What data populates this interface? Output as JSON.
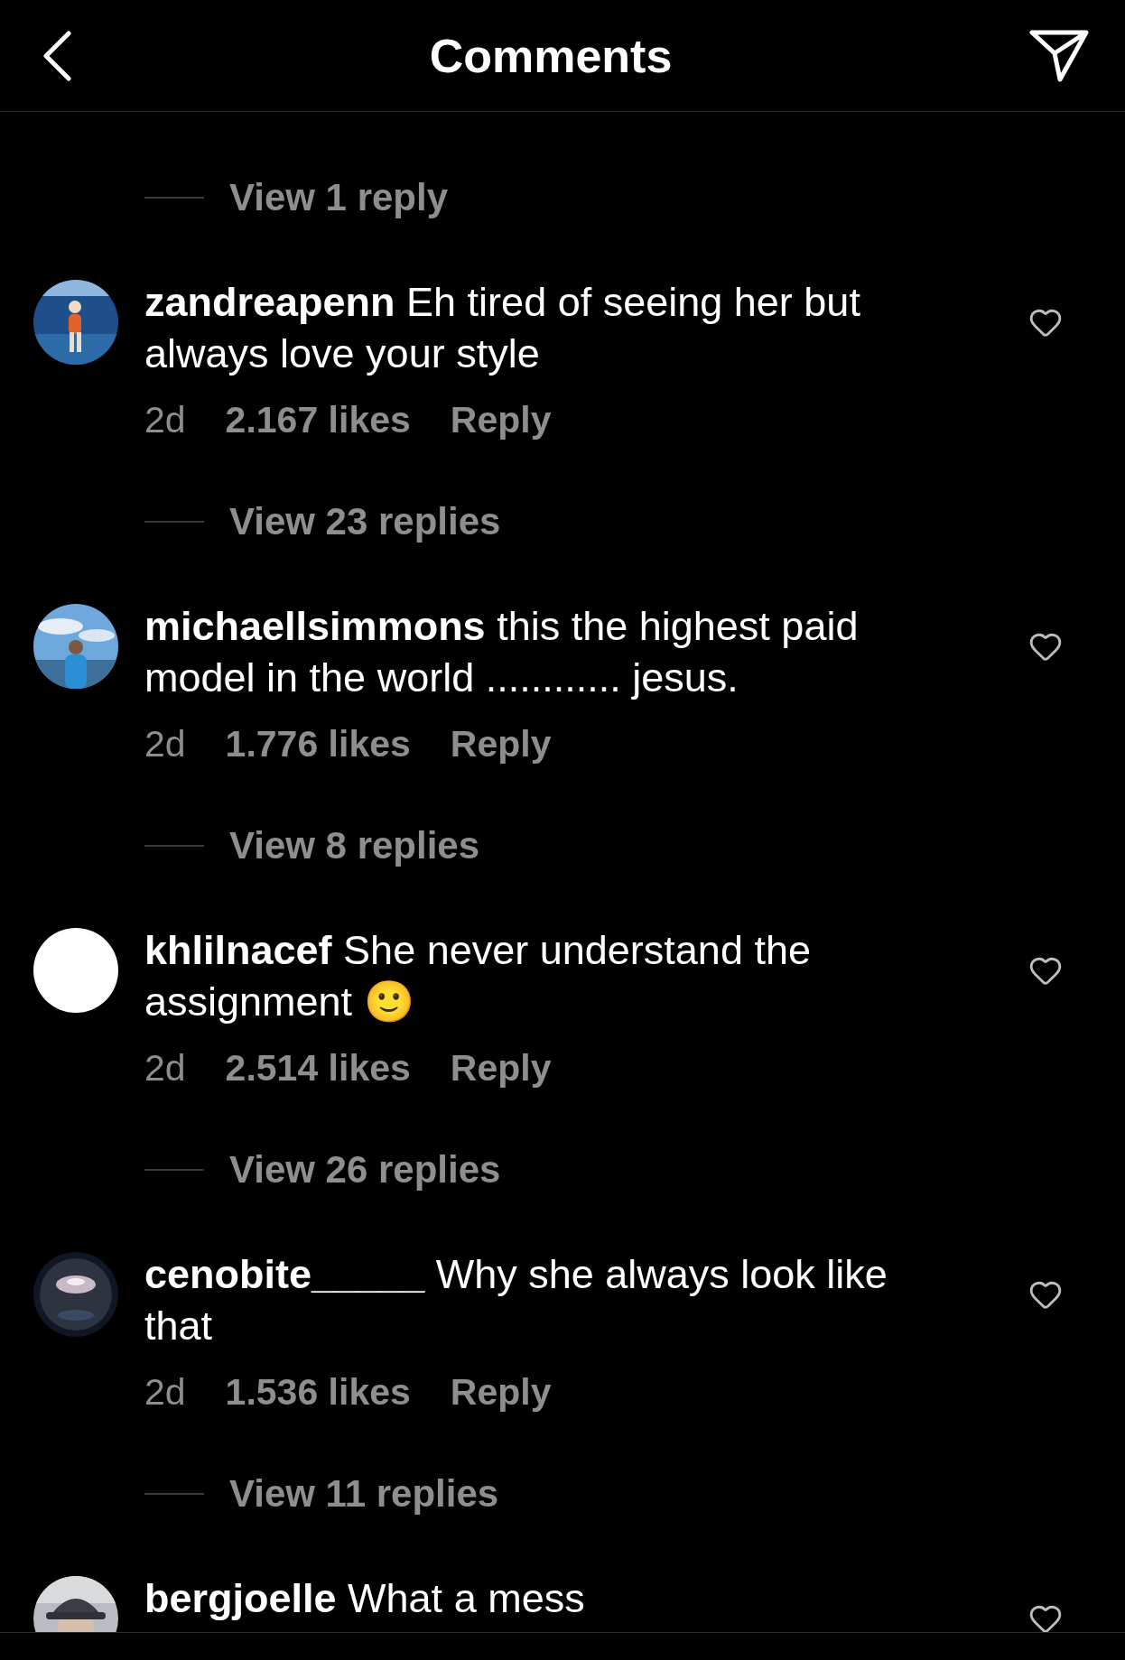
{
  "header": {
    "title": "Comments"
  },
  "comments": [
    {
      "view_replies": "View 1 reply",
      "user": "zandreapenn",
      "text": "Eh tired of seeing her but always love your style",
      "time": "2d",
      "likes": "2.167 likes",
      "reply": "Reply"
    },
    {
      "view_replies": "View 23 replies",
      "user": "michaellsimmons",
      "text": "this the highest paid model in the world ............ jesus.",
      "time": "2d",
      "likes": "1.776 likes",
      "reply": "Reply"
    },
    {
      "view_replies": "View 8 replies",
      "user": "khlilnacef",
      "text": "She never understand the assignment 🙂",
      "time": "2d",
      "likes": "2.514 likes",
      "reply": "Reply",
      "avatar": {
        "kind": "blank"
      }
    },
    {
      "view_replies": "View 26 replies",
      "user": "cenobite_____",
      "text": "Why she always look like that",
      "time": "2d",
      "likes": "1.536 likes",
      "reply": "Reply"
    },
    {
      "view_replies": "View 11 replies",
      "user": "bergjoelle",
      "text": "What a mess"
    }
  ]
}
